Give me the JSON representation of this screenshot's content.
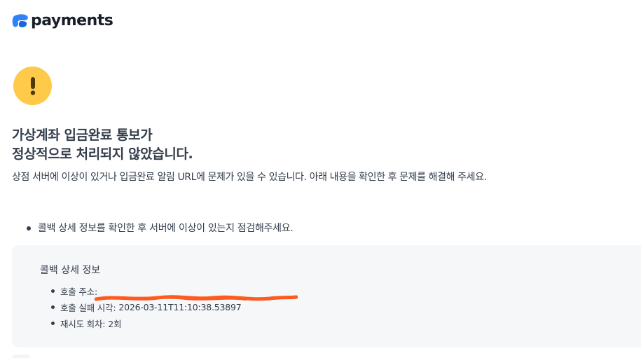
{
  "header": {
    "logo_text": "payments"
  },
  "status": {
    "icon": "warning-icon",
    "title_line1": "가상계좌 입금완료 통보가",
    "title_line2": "정상적으로 처리되지 않았습니다.",
    "description": "상점 서버에 이상이 있거나 입금완료 알림 URL에 문제가 있을 수 있습니다. 아래 내용을 확인한 후 문제를 해결해 주세요."
  },
  "notice": {
    "text": "콜백 상세 정보를 확인한 후 서버에 이상이 있는지 점검해주세요."
  },
  "callback": {
    "title": "콜백 상세 정보",
    "items": [
      {
        "label": "호출 주소:",
        "value": ""
      },
      {
        "label": "호출 실패 시각:",
        "value": "2026-03-11T11:10:38.53897"
      },
      {
        "label": "재시도 회차:",
        "value": "2회"
      }
    ]
  },
  "colors": {
    "brand": "#3182f6",
    "warning": "#ffc94a",
    "redaction": "#ff5a1f",
    "box_bg": "#f6f7f9"
  }
}
